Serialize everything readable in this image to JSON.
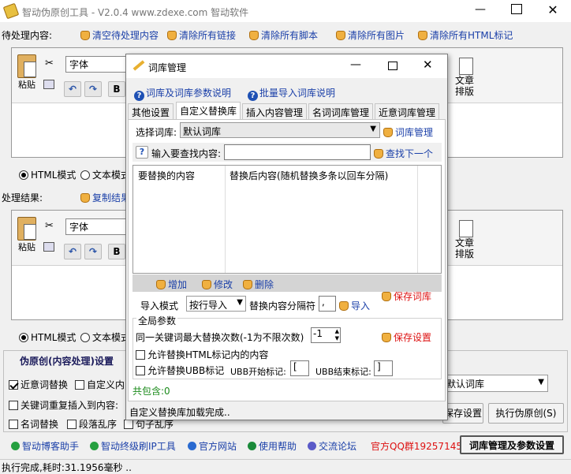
{
  "window": {
    "title": "智动伪原创工具  - V2.0.4  www.zdexe.com 智动软件"
  },
  "input_section": {
    "label": "待处理内容:",
    "links": [
      "清空待处理内容",
      "清除所有链接",
      "清除所有脚本",
      "清除所有图片",
      "清除所有HTML标记"
    ]
  },
  "editor1": {
    "paste": "粘贴",
    "font": "字体",
    "bold": "B",
    "article_layout": "文章\n排版",
    "mode_html": "HTML模式",
    "mode_text": "文本模式"
  },
  "result_section": {
    "label": "处理结果:",
    "copy_link": "复制结果"
  },
  "editor2": {
    "paste": "粘贴",
    "font": "字体",
    "bold": "B",
    "article_layout": "文章\n排版",
    "mode_html": "HTML模式",
    "mode_text": "文本模式"
  },
  "settings": {
    "title": "伪原创(内容处理)设置",
    "near_replace": "近意词替换",
    "custom": "自定义内",
    "keyword_repeat": "关键词重复插入到内容:",
    "name_replace": "名词替换",
    "paragraph_shuffle": "段落乱序",
    "sentence_shuffle": "句子乱序",
    "lexicon_value": "默认词库",
    "save_settings": "保存设置",
    "execute": "执行伪原创(S)"
  },
  "bottom_links": [
    "智动博客助手",
    "智动终级刷IP工具",
    "官方网站",
    "使用帮助",
    "交流论坛"
  ],
  "qq_group": "官方QQ群19257145",
  "lexicon_manage_button": "词库管理及参数设置",
  "status": "执行完成,耗时:31.1956毫秒 ..",
  "dialog": {
    "title": "词库管理",
    "help1": "词库及词库参数说明",
    "help2": "批量导入词库说明",
    "tabs": [
      "其他设置",
      "自定义替换库",
      "插入内容管理",
      "名词词库管理",
      "近意词库管理"
    ],
    "active_tab": 1,
    "select_label": "选择词库:",
    "select_value": "默认词库",
    "manage_link": "词库管理",
    "search_label": "输入要查找内容:",
    "search_value": "",
    "find_next": "查找下一个",
    "col1": "要替换的内容",
    "col2": "替换后内容(随机替换多条以回车分隔)",
    "add": "增加",
    "modify": "修改",
    "delete": "删除",
    "save_lexicon": "保存词库",
    "import_mode_label": "导入模式",
    "import_mode_value": "按行导入",
    "separator_label": "替换内容分隔符",
    "separator_value": ",",
    "import": "导入",
    "global_params": "全局参数",
    "max_replace_label": "同一关键词最大替换次数(-1为不限次数)",
    "max_replace_value": "-1",
    "save_settings": "保存设置",
    "allow_html": "允许替换HTML标记内的内容",
    "allow_ubb": "允许替换UBB标记",
    "ubb_start_label": "UBB开始标记:",
    "ubb_start_value": "[",
    "ubb_end_label": "UBB结束标记:",
    "ubb_end_value": "]",
    "total": "共包含:0",
    "status": "自定义替换库加载完成.."
  },
  "colors": {
    "link": "#1a3fa8",
    "red": "#dd1111",
    "green": "#1a8a1a"
  }
}
